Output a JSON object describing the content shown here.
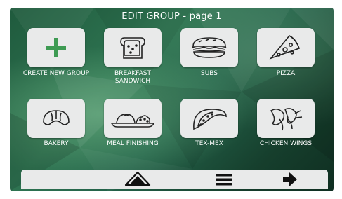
{
  "header": {
    "title": "EDIT GROUP - page 1"
  },
  "groups": [
    {
      "label": "CREATE NEW GROUP",
      "icon": "plus-icon"
    },
    {
      "label": "BREAKFAST SANDWICH",
      "icon": "sandwich-icon"
    },
    {
      "label": "SUBS",
      "icon": "sub-sandwich-icon"
    },
    {
      "label": "PIZZA",
      "icon": "pizza-slice-icon"
    },
    {
      "label": "BAKERY",
      "icon": "croissant-icon"
    },
    {
      "label": "MEAL FINISHING",
      "icon": "plated-meal-icon"
    },
    {
      "label": "TEX-MEX",
      "icon": "taco-icon"
    },
    {
      "label": "CHICKEN WINGS",
      "icon": "chicken-wings-icon"
    }
  ],
  "navbar": {
    "home_icon": "home-icon",
    "menu_icon": "menu-icon",
    "next_icon": "arrow-right-icon"
  },
  "colors": {
    "accent_green": "#3e9b53",
    "tile_bg": "#e9eaea",
    "background_dark_green": "#1f5a3d"
  }
}
